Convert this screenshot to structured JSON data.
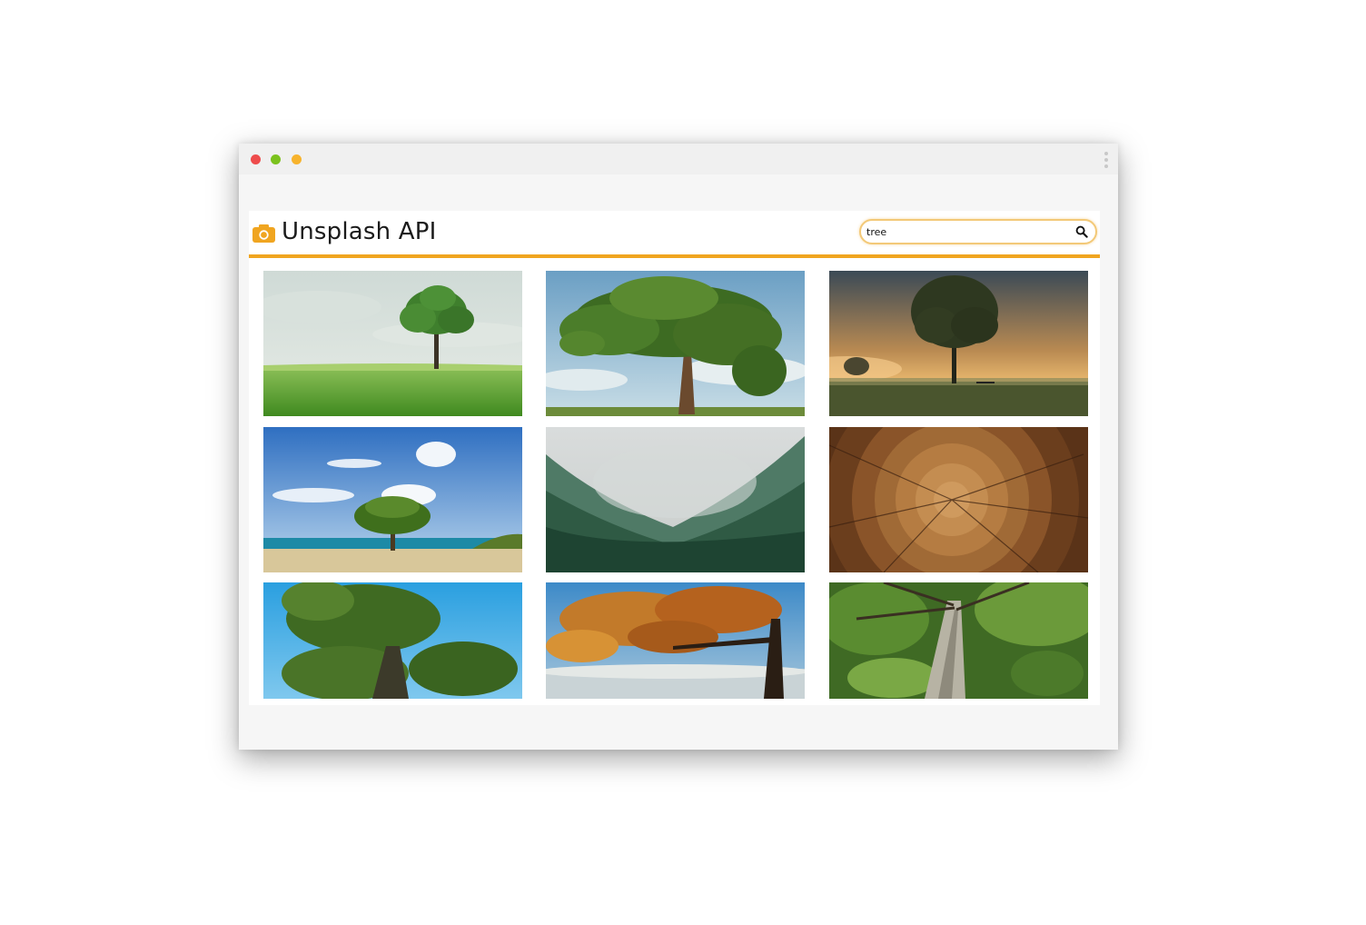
{
  "window": {
    "controls": [
      "close-dot",
      "minimize-dot",
      "maximize-dot"
    ],
    "colors": {
      "close": "#ee4c4c",
      "minimize": "#7bc21d",
      "maximize": "#f7b32d"
    }
  },
  "header": {
    "logo_icon": "camera-icon",
    "title": "Unsplash API",
    "accent": "#f0a520"
  },
  "search": {
    "value": "tree",
    "button_icon": "search-icon"
  },
  "results": [
    {
      "subject": "lone-tree-on-grass-field"
    },
    {
      "subject": "large-oak-tree-blue-sky"
    },
    {
      "subject": "tree-in-misty-sunrise-field"
    },
    {
      "subject": "tree-on-tropical-beach"
    },
    {
      "subject": "foggy-pine-forest-valley"
    },
    {
      "subject": "tree-trunk-rings-cross-section"
    },
    {
      "subject": "green-tree-canopy-blue-sky"
    },
    {
      "subject": "autumn-tree-over-lake"
    },
    {
      "subject": "looking-up-tree-trunk-canopy"
    }
  ]
}
